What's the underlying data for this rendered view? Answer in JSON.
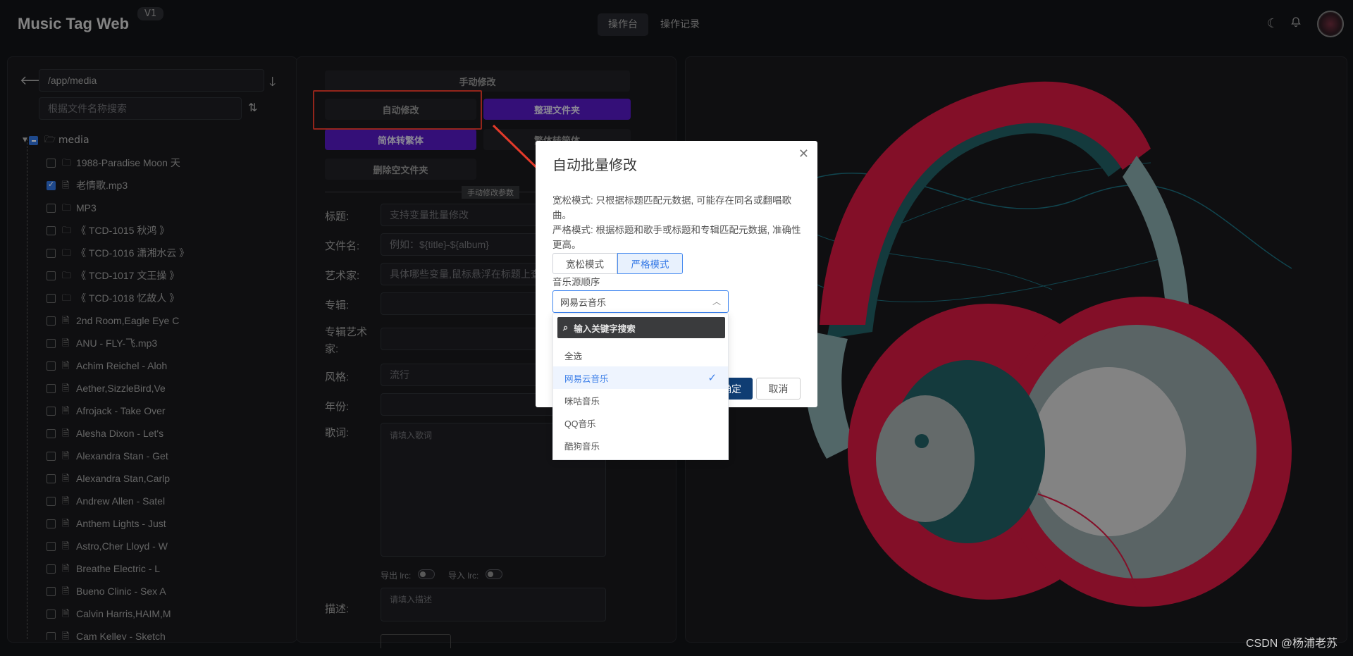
{
  "header": {
    "app_title": "Music Tag Web",
    "version": "V1",
    "tabs": [
      "操作台",
      "操作记录"
    ],
    "icons": [
      "moon-icon",
      "bell-icon",
      "avatar"
    ]
  },
  "left": {
    "path_value": "/app/media",
    "search_placeholder": "根据文件名称搜索",
    "root": "media",
    "items": [
      {
        "label": "1988-Paradise Moon 天",
        "type": "folder",
        "checked": false
      },
      {
        "label": "老情歌.mp3",
        "type": "file",
        "checked": true
      },
      {
        "label": "MP3",
        "type": "folder",
        "checked": false
      },
      {
        "label": "《 TCD-1015 秋鸿 》",
        "type": "folder",
        "checked": false
      },
      {
        "label": "《 TCD-1016 潇湘水云 》",
        "type": "folder",
        "checked": false
      },
      {
        "label": "《 TCD-1017 文王操 》",
        "type": "folder",
        "checked": false
      },
      {
        "label": "《 TCD-1018 忆故人 》",
        "type": "folder",
        "checked": false
      },
      {
        "label": "2nd Room,Eagle Eye C",
        "type": "file",
        "checked": false
      },
      {
        "label": "ANU - FLY-飞.mp3",
        "type": "file",
        "checked": false
      },
      {
        "label": "Achim Reichel - Aloh",
        "type": "file",
        "checked": false
      },
      {
        "label": "Aether,SizzleBird,Ve",
        "type": "file",
        "checked": false
      },
      {
        "label": "Afrojack - Take Over",
        "type": "file",
        "checked": false
      },
      {
        "label": "Alesha Dixon - Let's",
        "type": "file",
        "checked": false
      },
      {
        "label": "Alexandra Stan - Get",
        "type": "file",
        "checked": false
      },
      {
        "label": "Alexandra Stan,Carlp",
        "type": "file",
        "checked": false
      },
      {
        "label": "Andrew Allen - Satel",
        "type": "file",
        "checked": false
      },
      {
        "label": "Anthem Lights - Just",
        "type": "file",
        "checked": false
      },
      {
        "label": "Astro,Cher Lloyd - W",
        "type": "file",
        "checked": false
      },
      {
        "label": "Breathe Electric - L",
        "type": "file",
        "checked": false
      },
      {
        "label": "Bueno Clinic - Sex A",
        "type": "file",
        "checked": false
      },
      {
        "label": "Calvin Harris,HAIM,M",
        "type": "file",
        "checked": false
      },
      {
        "label": "Cam Kelley - Sketch",
        "type": "file",
        "checked": false
      }
    ]
  },
  "middle": {
    "btn_manual": "手动修改",
    "btn_auto": "自动修改",
    "btn_organize": "整理文件夹",
    "btn_s2t": "简体转繁体",
    "btn_t2s": "繁体转简体",
    "btn_delete_empty": "删除空文件夹",
    "section_label": "手动修改参数",
    "fields": {
      "title_label": "标题:",
      "title_ph": "支持变量批量修改",
      "filename_label": "文件名:",
      "filename_ph": "例如：${title}-${album}",
      "artist_label": "艺术家:",
      "artist_ph": "具体哪些变量,鼠标悬浮在标题上查看",
      "album_label": "专辑:",
      "album_artist_label": "专辑艺术家:",
      "genre_label": "风格:",
      "genre_ph": "流行",
      "year_label": "年份:",
      "lyrics_label": "歌词:",
      "lyrics_ph": "请填入歌词",
      "export_lrc": "导出 lrc:",
      "import_lrc": "导入 lrc:",
      "desc_label": "描述:",
      "desc_ph": "请填入描述"
    }
  },
  "dialog": {
    "title": "自动批量修改",
    "loose_desc": "宽松模式: 只根据标题匹配元数据, 可能存在同名或翻唱歌曲。",
    "strict_desc": "严格模式: 根据标题和歌手或标题和专辑匹配元数据, 准确性更高。",
    "mode_loose": "宽松模式",
    "mode_strict": "严格模式",
    "selected_mode": "严格模式",
    "source_label": "音乐源顺序",
    "source_value": "网易云音乐",
    "confirm": "确定",
    "cancel": "取消"
  },
  "dropdown": {
    "search_placeholder": "输入关键字搜索",
    "options": [
      "全选",
      "网易云音乐",
      "咪咕音乐",
      "QQ音乐",
      "酷狗音乐"
    ],
    "selected": "网易云音乐"
  },
  "watermark": "CSDN @杨浦老苏",
  "colors": {
    "accent_purple": "#5018b8",
    "highlight_red": "#e23a2a",
    "select_blue": "#3b7ee8"
  }
}
